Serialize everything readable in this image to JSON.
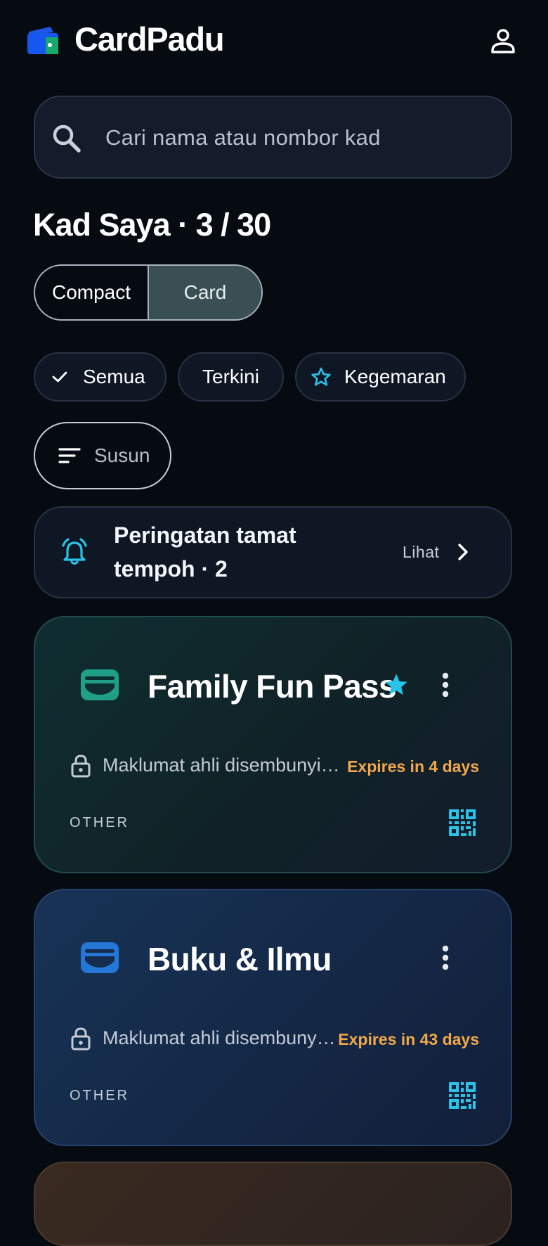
{
  "app": {
    "title": "CardPadu",
    "logo_icon": "wallet-logo-icon",
    "account_icon": "account-icon"
  },
  "search": {
    "placeholder": "Cari nama atau nombor kad",
    "value": ""
  },
  "section": {
    "title": "Kad Saya · 3 / 30"
  },
  "view_toggle": {
    "options": [
      "Compact",
      "Card"
    ],
    "selected": "Card"
  },
  "filters": {
    "chips": [
      {
        "label": "Semua",
        "icon": "check-icon",
        "selected": true
      },
      {
        "label": "Terkini",
        "selected": false
      },
      {
        "label": "Kegemaran",
        "icon": "star-outline-icon",
        "selected": false
      }
    ],
    "sort_label": "Susun"
  },
  "expiry_banner": {
    "text": "Peringatan tamat tempoh · 2",
    "action_label": "Lihat",
    "icon": "alarm-bell-icon"
  },
  "cards": [
    {
      "name": "Family Fun Pass",
      "favorite": true,
      "hidden_text": "Maklumat ahli disembunyikan",
      "expires": "Expires in 4 days",
      "type": "OTHER",
      "icon_color": "#1f9f86"
    },
    {
      "name": "Buku & Ilmu",
      "favorite": false,
      "hidden_text": "Maklumat ahli disembunyikan",
      "expires": "Expires in 43 days",
      "type": "OTHER",
      "icon_color": "#2477d6"
    }
  ],
  "colors": {
    "background": "#060a11",
    "accent": "#29c3ea",
    "warning": "#f2a84a",
    "toggle_selected": "#3a4f53"
  }
}
